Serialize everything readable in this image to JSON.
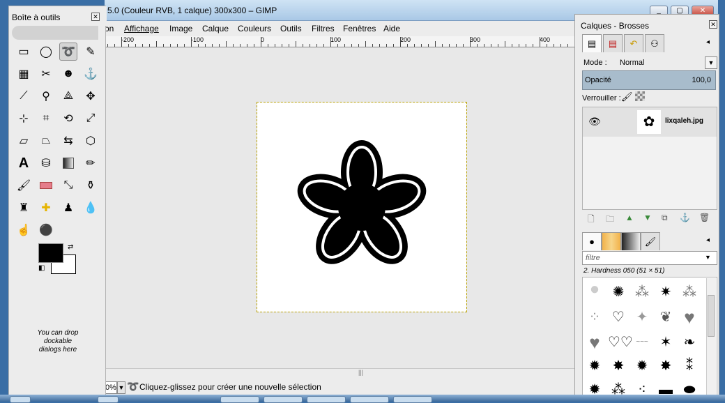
{
  "main_window": {
    "title": "5.0 (Couleur RVB, 1 calque) 300x300 – GIMP",
    "menu": [
      "on",
      "Affichage",
      "Image",
      "Calque",
      "Couleurs",
      "Outils",
      "Filtres",
      "Fenêtres",
      "Aide"
    ],
    "ruler_labels": [
      "-200",
      "-100",
      "0",
      "100",
      "200",
      "300",
      "400"
    ],
    "zoom_value": "0%",
    "status_message": "Cliquez-glissez pour créer une nouvelle sélection",
    "image_size": "300x300"
  },
  "toolbox": {
    "title": "Boîte à outils",
    "dock_hint": "You can drop dockable dialogs here",
    "tools": [
      "rect-select-icon",
      "ellipse-select-icon",
      "free-select-icon",
      "fuzzy-select-icon",
      "select-by-color-icon",
      "scissors-icon",
      "foreground-select-icon",
      "paths-icon",
      "color-picker-icon",
      "zoom-icon",
      "measure-icon",
      "move-icon",
      "align-icon",
      "crop-icon",
      "rotate-icon",
      "scale-icon",
      "shear-icon",
      "perspective-icon",
      "flip-icon",
      "cage-icon",
      "text-icon",
      "bucket-fill-icon",
      "blend-icon",
      "pencil-icon",
      "paintbrush-icon",
      "eraser-icon",
      "airbrush-icon",
      "ink-icon",
      "clone-icon",
      "heal-icon",
      "perspective-clone-icon",
      "blur-icon",
      "smudge-icon",
      "dodge-burn-icon"
    ],
    "foreground_color": "#000000",
    "background_color": "#ffffff"
  },
  "dock": {
    "title": "Calques - Brosses",
    "mode_label": "Mode :",
    "mode_value": "Normal",
    "opacity_label": "Opacité",
    "opacity_value": "100,0",
    "lock_label": "Verrouiller :",
    "layer_name": "lixqaleh.jpg",
    "filter_placeholder": "filtre",
    "brush_name": "2. Hardness 050 (51 × 51)"
  }
}
